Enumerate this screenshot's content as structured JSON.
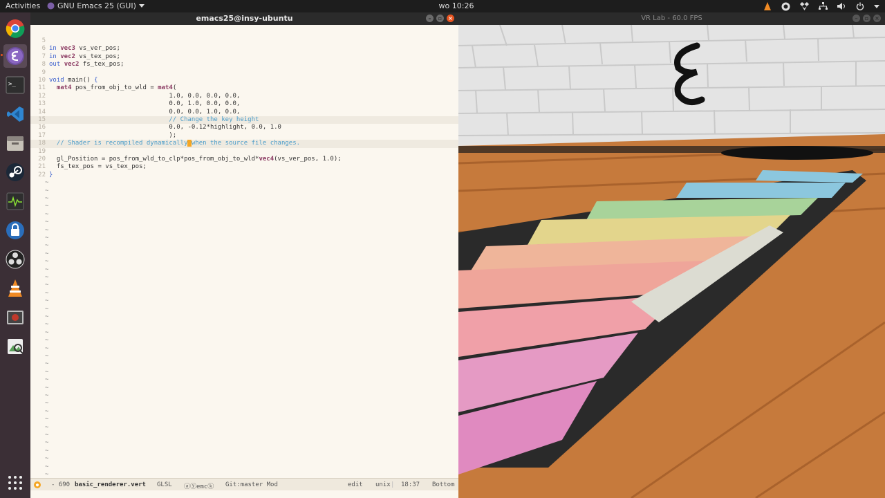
{
  "topbar": {
    "activities": "Activities",
    "app_menu": "GNU Emacs 25 (GUI)",
    "clock": "wo 10:26"
  },
  "dock": {
    "items": [
      "chrome-icon",
      "emacs-icon",
      "terminal-icon",
      "vscode-icon",
      "files-icon",
      "steam-icon",
      "system-monitor-icon",
      "keepass-icon",
      "obs-icon",
      "vlc-icon",
      "recorder-icon",
      "image-viewer-icon",
      "app-grid-icon"
    ]
  },
  "emacs": {
    "title": "emacs25@insy-ubuntu",
    "lines": [
      {
        "n": "5",
        "parts": []
      },
      {
        "n": "6",
        "parts": [
          [
            "kw",
            "in "
          ],
          [
            "ty",
            "vec3"
          ],
          [
            "",
            " vs_ver_pos;"
          ]
        ]
      },
      {
        "n": "7",
        "parts": [
          [
            "kw",
            "in "
          ],
          [
            "ty",
            "vec2"
          ],
          [
            "",
            " vs_tex_pos;"
          ]
        ]
      },
      {
        "n": "8",
        "parts": [
          [
            "kw",
            "out "
          ],
          [
            "ty",
            "vec2"
          ],
          [
            "",
            " fs_tex_pos;"
          ]
        ]
      },
      {
        "n": "9",
        "parts": []
      },
      {
        "n": "10",
        "parts": [
          [
            "kw",
            "void"
          ],
          [
            "",
            " main() "
          ],
          [
            "kw",
            "{"
          ]
        ]
      },
      {
        "n": "11",
        "parts": [
          [
            "",
            "  "
          ],
          [
            "ty",
            "mat4"
          ],
          [
            "",
            " pos_from_obj_to_wld = "
          ],
          [
            "ty",
            "mat4"
          ],
          [
            "",
            "("
          ]
        ]
      },
      {
        "n": "12",
        "parts": [
          [
            "",
            "                                1.0, 0.0, 0.0, 0.0,"
          ]
        ]
      },
      {
        "n": "13",
        "parts": [
          [
            "",
            "                                0.0, 1.0, 0.0, 0.0,"
          ]
        ]
      },
      {
        "n": "14",
        "parts": [
          [
            "",
            "                                0.0, 0.0, 1.0, 0.0,"
          ]
        ]
      },
      {
        "n": "15",
        "hl": true,
        "parts": [
          [
            "cm",
            "                                // Change the key height"
          ]
        ]
      },
      {
        "n": "16",
        "parts": [
          [
            "",
            "                                0.0, -0.12*highlight, 0.0, 1.0"
          ]
        ]
      },
      {
        "n": "17",
        "parts": [
          [
            "",
            "                                );"
          ]
        ]
      },
      {
        "n": "18",
        "hl": true,
        "parts": [
          [
            "cm",
            "  // Shader is recompiled dynamically"
          ],
          [
            "cursor",
            " "
          ],
          [
            "cm",
            "when the source file changes."
          ]
        ]
      },
      {
        "n": "19",
        "parts": []
      },
      {
        "n": "20",
        "parts": [
          [
            "",
            "  gl_Position = pos_from_wld_to_clp*pos_from_obj_to_wld*"
          ],
          [
            "ty",
            "vec4"
          ],
          [
            "",
            "(vs_ver_pos, 1.0);"
          ]
        ]
      },
      {
        "n": "21",
        "parts": [
          [
            "",
            "  fs_tex_pos = vs_tex_pos;"
          ]
        ]
      },
      {
        "n": "22",
        "parts": [
          [
            "kw",
            "}"
          ]
        ]
      }
    ],
    "tilde_count": 40,
    "modeline": {
      "state": "●",
      "size": "- 690",
      "filename": "basic_renderer.vert",
      "mode": "GLSL",
      "minor": "ⓐⓨemcⓚ",
      "vc": "Git:master Mod",
      "edit": "edit",
      "encoding": "unix",
      "position": "18:37",
      "scroll": "Bottom"
    }
  },
  "vr": {
    "title": "VR Lab - 60.0 FPS",
    "colors": {
      "wall": "#e6e6e6",
      "floor": "#c97a3a",
      "board": "#2c2c2c",
      "keys_pink": "#e59ac4",
      "keys_salmon": "#efa59a",
      "keys_yellow": "#e3d58c",
      "keys_green": "#a8d39a",
      "keys_blue": "#8cc7de",
      "spacebar": "#dcdcd2"
    }
  }
}
